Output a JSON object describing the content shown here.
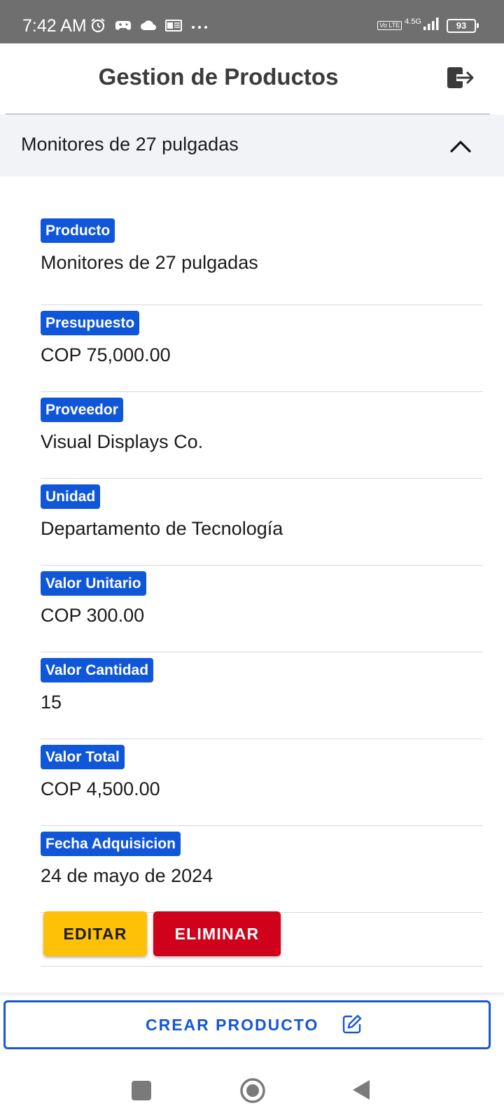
{
  "status_bar": {
    "time": "7:42 AM",
    "volte": "Vo LTE",
    "network": "4.5G",
    "battery": "93"
  },
  "app_bar": {
    "title": "Gestion de Productos"
  },
  "accordion": {
    "title": "Monitores de 27 pulgadas"
  },
  "fields": [
    {
      "label": "Producto",
      "value": "Monitores de 27 pulgadas"
    },
    {
      "label": "Presupuesto",
      "value": "COP 75,000.00"
    },
    {
      "label": "Proveedor",
      "value": "Visual Displays Co."
    },
    {
      "label": "Unidad",
      "value": "Departamento de Tecnología"
    },
    {
      "label": "Valor Unitario",
      "value": "COP 300.00"
    },
    {
      "label": "Valor Cantidad",
      "value": "15"
    },
    {
      "label": "Valor Total",
      "value": "COP 4,500.00"
    },
    {
      "label": "Fecha Adquisicion",
      "value": "24 de mayo de 2024"
    }
  ],
  "actions": {
    "edit_label": "EDITAR",
    "delete_label": "ELIMINAR"
  },
  "create": {
    "label": "CREAR PRODUCTO"
  },
  "colors": {
    "badge": "#0f56d9",
    "edit": "#ffc107",
    "delete": "#d0021b",
    "primary": "#1557d6"
  },
  "icons": {
    "logout": "logout-icon",
    "collapse": "chevron-up-icon",
    "create": "edit-icon"
  }
}
